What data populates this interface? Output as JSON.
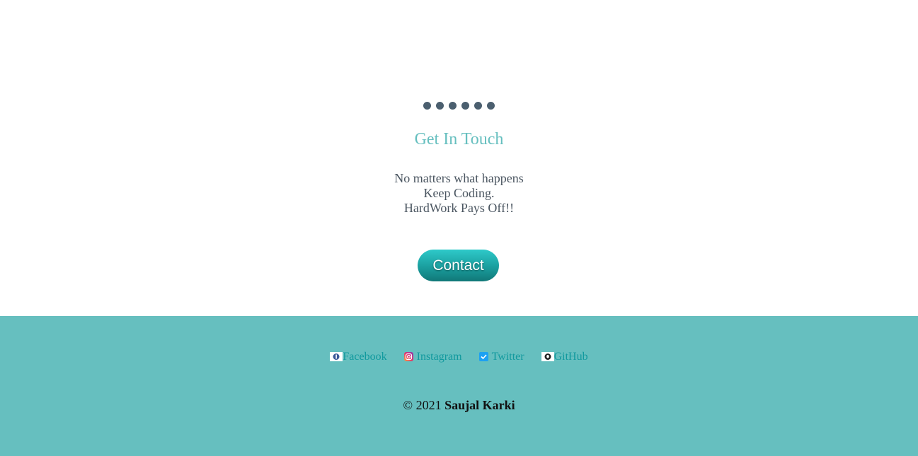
{
  "section": {
    "title": "Get In Touch",
    "motto_lines": [
      "No matters what happens",
      "Keep Coding.",
      "HardWork Pays Off!!"
    ],
    "contact_label": "Contact"
  },
  "footer": {
    "links": [
      {
        "label": "Facebook",
        "icon": "facebook-icon"
      },
      {
        "label": "Instagram",
        "icon": "instagram-icon"
      },
      {
        "label": "Twitter",
        "icon": "twitter-icon"
      },
      {
        "label": "GitHub",
        "icon": "github-icon"
      }
    ],
    "copyright_prefix": "© 2021",
    "copyright_name": "Saujal Karki"
  },
  "colors": {
    "accent": "#66bfbf",
    "link": "#11999e",
    "dot": "#4b5f6f"
  }
}
